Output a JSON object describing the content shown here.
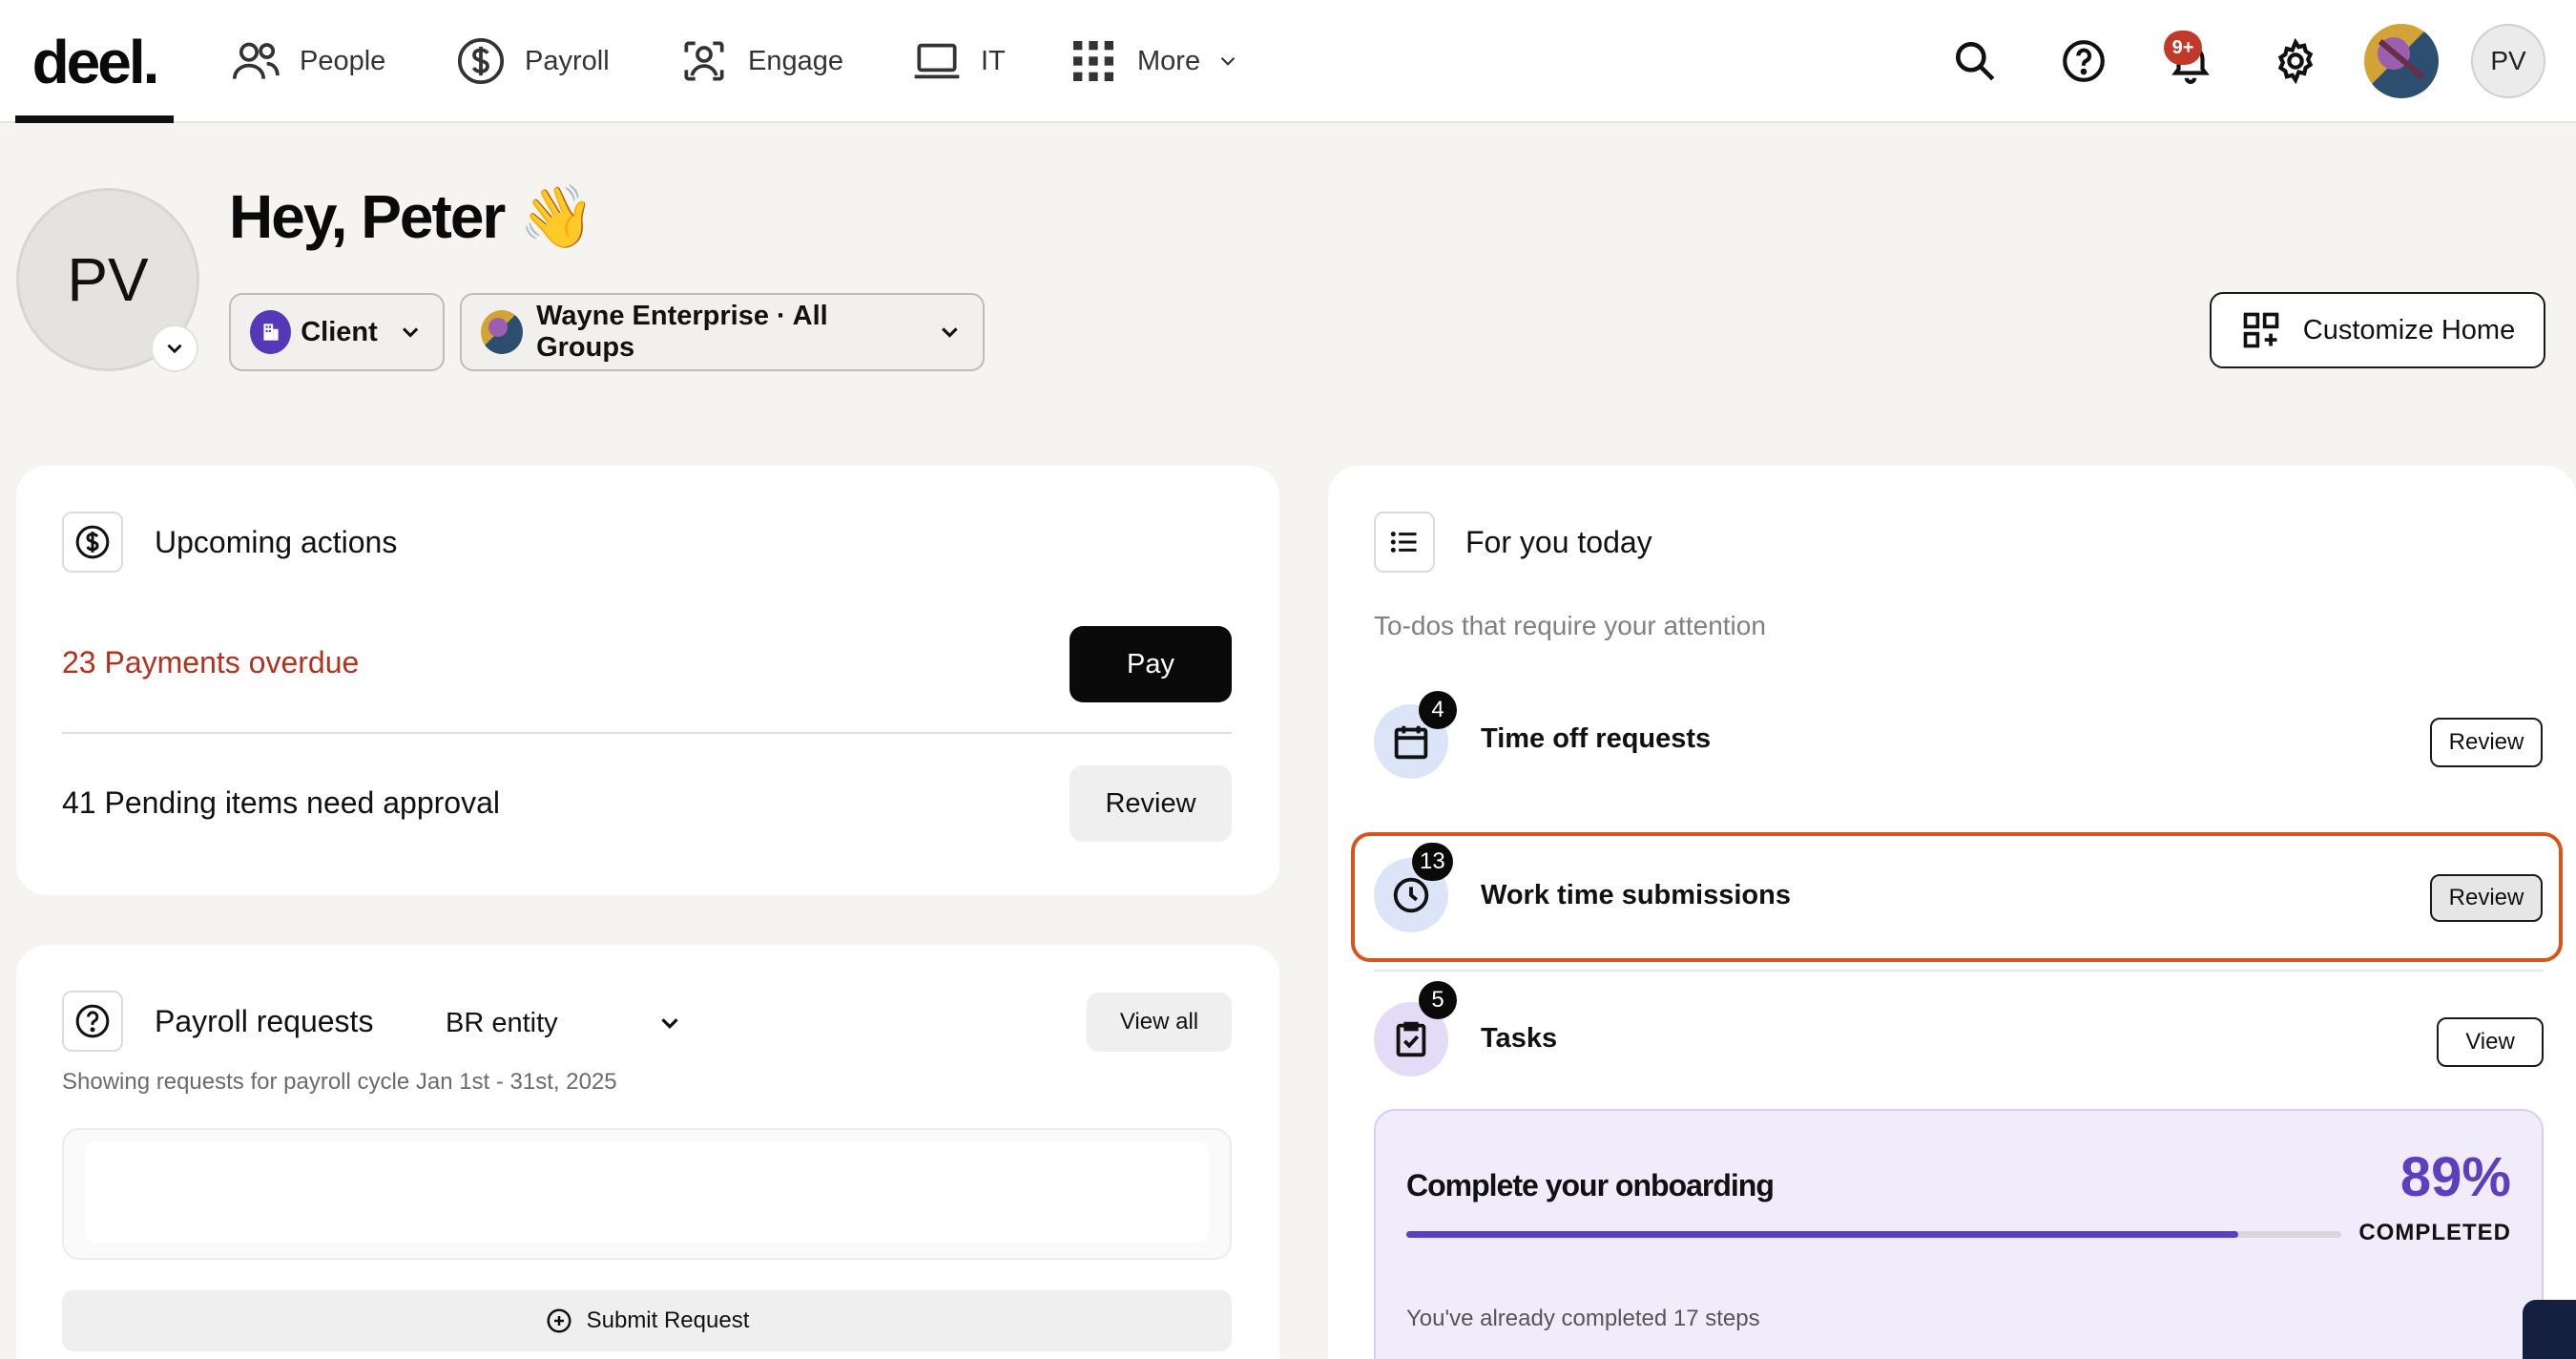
{
  "nav": {
    "logo": "deel.",
    "items": [
      {
        "label": "People",
        "icon": "people-icon"
      },
      {
        "label": "Payroll",
        "icon": "dollar-circle-icon"
      },
      {
        "label": "Engage",
        "icon": "engage-icon"
      },
      {
        "label": "IT",
        "icon": "laptop-icon"
      },
      {
        "label": "More",
        "icon": "grid-icon"
      }
    ],
    "notification_badge": "9+",
    "user_initials": "PV"
  },
  "greeting": {
    "avatar_initials": "PV",
    "title": "Hey, Peter 👋",
    "role_label": "Client",
    "organization_label": "Wayne Enterprise · All Groups",
    "customize_label": "Customize Home"
  },
  "upcoming_actions": {
    "title": "Upcoming actions",
    "overdue_text": "23 Payments overdue",
    "pay_label": "Pay",
    "pending_text": "41 Pending items need approval",
    "review_label": "Review"
  },
  "payroll_requests": {
    "title": "Payroll requests",
    "entity_selected": "BR entity",
    "view_all_label": "View all",
    "subtitle": "Showing requests for payroll cycle Jan 1st - 31st, 2025",
    "submit_label": "Submit Request"
  },
  "for_you_today": {
    "title": "For you today",
    "subtitle": "To-dos that require your attention",
    "items": [
      {
        "label": "Time off requests",
        "count": "4",
        "action": "Review",
        "icon": "calendar-icon"
      },
      {
        "label": "Work time submissions",
        "count": "13",
        "action": "Review",
        "icon": "clock-icon"
      },
      {
        "label": "Tasks",
        "count": "5",
        "action": "View",
        "icon": "clipboard-check-icon"
      }
    ]
  },
  "onboarding": {
    "title": "Complete your onboarding",
    "percent_text": "89%",
    "percent_value": 0.89,
    "completed_label": "COMPLETED",
    "steps_text": "You've already completed 17 steps"
  },
  "colors": {
    "accent_purple": "#5b3fbf",
    "overdue_red": "#b3321f",
    "highlight_orange": "#d9531e",
    "notification_red": "#c0392b"
  }
}
